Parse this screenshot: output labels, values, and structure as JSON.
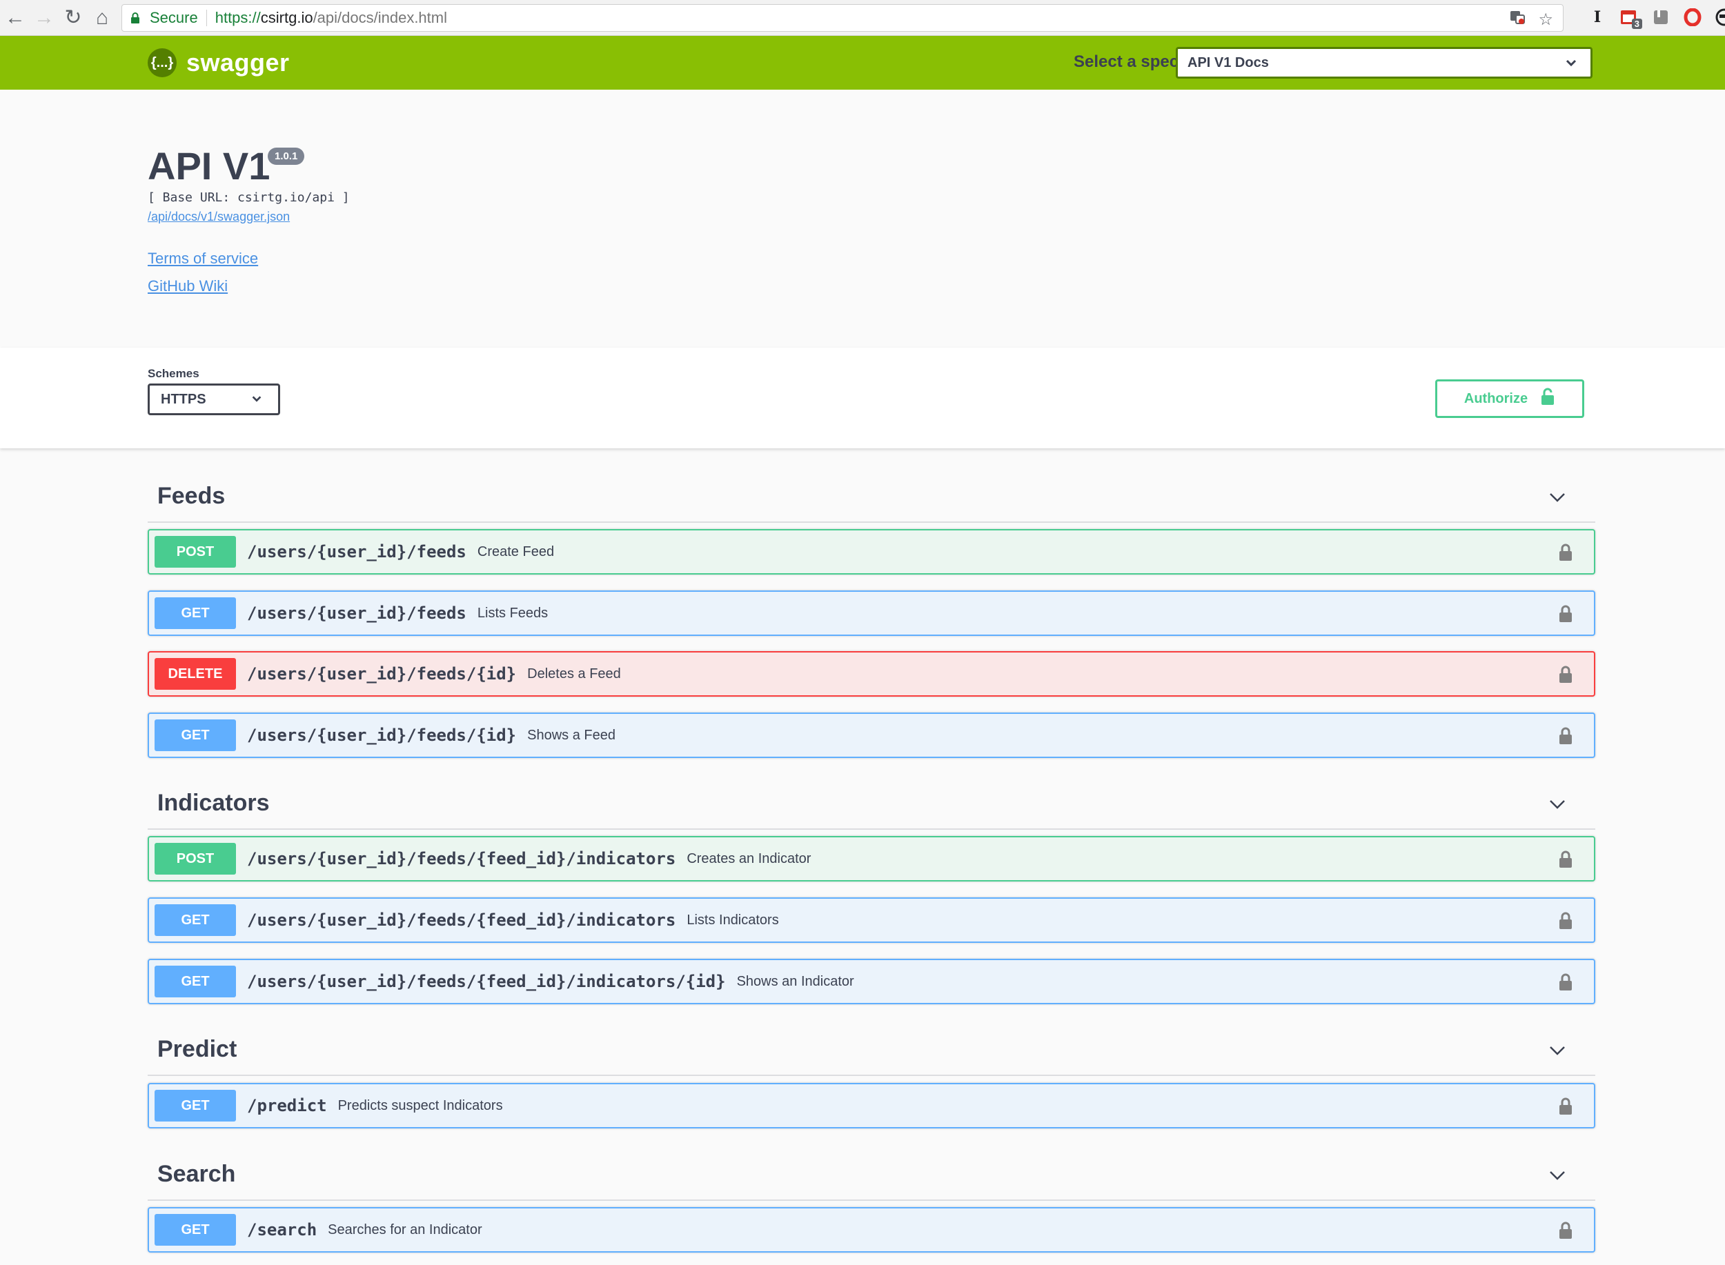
{
  "browser": {
    "secure_label": "Secure",
    "url_scheme": "https://",
    "url_host": "csirtg.io",
    "url_path": "/api/docs/index.html",
    "extension_badge": "3"
  },
  "topbar": {
    "logo_text": "swagger",
    "logo_glyph": "{...}",
    "spec_label": "Select a spec",
    "spec_value": "API V1 Docs"
  },
  "info": {
    "title": "API V1",
    "version": "1.0.1",
    "base_url": "[ Base URL: csirtg.io/api ]",
    "spec_link": "/api/docs/v1/swagger.json",
    "terms_link": "Terms of service",
    "wiki_link": "GitHub Wiki"
  },
  "schemes": {
    "label": "Schemes",
    "value": "HTTPS",
    "authorize_label": "Authorize"
  },
  "colors": {
    "topbar": "#89bf04",
    "post": "#49cc90",
    "get": "#61affe",
    "delete": "#f93e3e"
  },
  "sections": [
    {
      "title": "Feeds",
      "operations": [
        {
          "method": "POST",
          "path": "/users/{user_id}/feeds",
          "summary": "Create Feed"
        },
        {
          "method": "GET",
          "path": "/users/{user_id}/feeds",
          "summary": "Lists Feeds"
        },
        {
          "method": "DELETE",
          "path": "/users/{user_id}/feeds/{id}",
          "summary": "Deletes a Feed"
        },
        {
          "method": "GET",
          "path": "/users/{user_id}/feeds/{id}",
          "summary": "Shows a Feed"
        }
      ]
    },
    {
      "title": "Indicators",
      "operations": [
        {
          "method": "POST",
          "path": "/users/{user_id}/feeds/{feed_id}/indicators",
          "summary": "Creates an Indicator"
        },
        {
          "method": "GET",
          "path": "/users/{user_id}/feeds/{feed_id}/indicators",
          "summary": "Lists Indicators"
        },
        {
          "method": "GET",
          "path": "/users/{user_id}/feeds/{feed_id}/indicators/{id}",
          "summary": "Shows an Indicator"
        }
      ]
    },
    {
      "title": "Predict",
      "operations": [
        {
          "method": "GET",
          "path": "/predict",
          "summary": "Predicts suspect Indicators"
        }
      ]
    },
    {
      "title": "Search",
      "operations": [
        {
          "method": "GET",
          "path": "/search",
          "summary": "Searches for an Indicator"
        }
      ]
    }
  ]
}
